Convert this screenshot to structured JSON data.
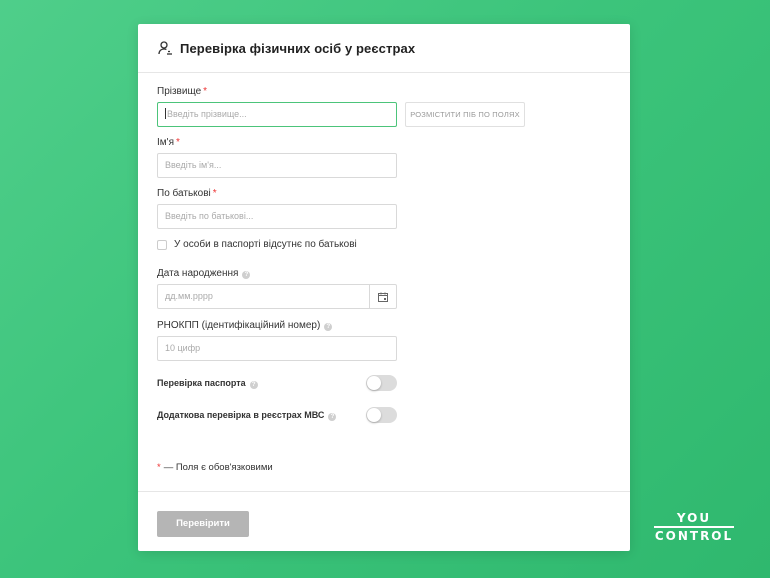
{
  "header": {
    "title": "Перевірка фізичних осіб у реєстрах",
    "icon": "user-search-icon"
  },
  "form": {
    "surname": {
      "label": "Прізвище",
      "required_mark": "*",
      "placeholder": "Введіть прізвище..."
    },
    "split_button": "РОЗМІСТИТИ ПІБ ПО ПОЛЯХ",
    "first_name": {
      "label": "Ім'я",
      "required_mark": "*",
      "placeholder": "Введіть ім'я..."
    },
    "patronymic": {
      "label": "По батькові",
      "required_mark": "*",
      "placeholder": "Введіть по батькові..."
    },
    "no_patronymic_checkbox": "У особи в паспорті відсутнє по батькові",
    "birth_date": {
      "label": "Дата народження",
      "placeholder": "дд.мм.рррр"
    },
    "tax_id": {
      "label": "РНОКПП (ідентифікаційний номер)",
      "placeholder": "10 цифр"
    },
    "passport_check": {
      "label": "Перевірка паспорта",
      "enabled": false
    },
    "mvs_check": {
      "label": "Додаткова перевірка в реєстрах МВС",
      "enabled": false
    },
    "required_note": "— Поля є обов'язковими",
    "required_note_mark": "*"
  },
  "footer": {
    "submit_label": "Перевірити"
  },
  "logo": {
    "line1": "YOU",
    "line2": "CONTROL"
  },
  "colors": {
    "accent": "#4cc47a",
    "required": "#e33333",
    "submit_disabled": "#b5b5b5"
  }
}
